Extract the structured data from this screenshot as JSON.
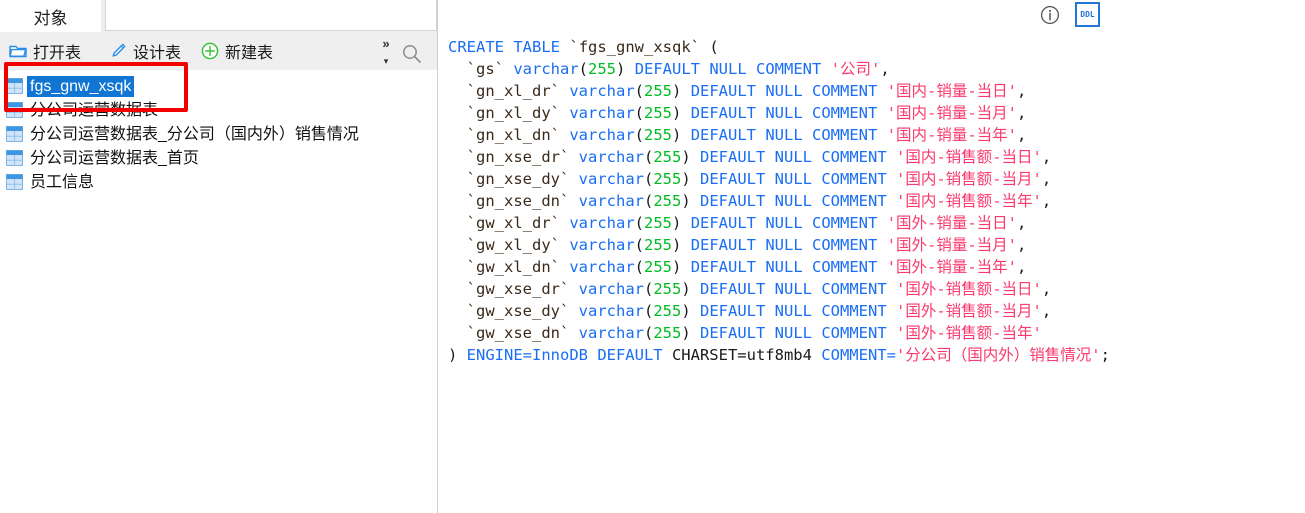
{
  "window": {
    "left_panel": {
      "tabs": [
        {
          "label": "对象",
          "name": "tab-object",
          "active": true
        }
      ],
      "toolbar": {
        "open_table_label": "打开表",
        "design_table_label": "设计表",
        "new_table_label": "新建表",
        "overflow_chevron": "»",
        "overflow_caret": "▾",
        "search_icon": "search-icon"
      },
      "object_list": [
        {
          "label": "fgs_gnw_xsqk",
          "selected": true,
          "icon": "table-icon"
        },
        {
          "label": "分公司运营数据表",
          "selected": false,
          "icon": "table-icon"
        },
        {
          "label": "分公司运营数据表_分公司（国内外）销售情况",
          "selected": false,
          "icon": "table-icon"
        },
        {
          "label": "分公司运营数据表_首页",
          "selected": false,
          "icon": "table-icon"
        },
        {
          "label": "员工信息",
          "selected": false,
          "icon": "table-icon"
        }
      ],
      "annotation": {
        "color": "#f20000",
        "shape": "rectangle",
        "target": "fgs_gnw_xsqk"
      }
    },
    "right_panel": {
      "toolbar": {
        "info_icon": "info-circle-icon",
        "ddl_button_label": "DDL"
      },
      "colors": {
        "keyword": "#1a6ef5",
        "identifier": "#3a2a1a",
        "number": "#00bb22",
        "string": "#fb3a6e",
        "plain": "#1a1a1a",
        "selection": "#1175d3",
        "annotation": "#f20000",
        "toolbar_bg": "#efefef"
      },
      "ddl": {
        "header": {
          "create": "CREATE",
          "table": "TABLE",
          "name": "`fgs_gnw_xsqk`",
          "paren": "("
        },
        "columns": [
          {
            "name": "`gs`",
            "type": "varchar",
            "length": "255",
            "nullability": "DEFAULT NULL",
            "comment_kw": "COMMENT",
            "comment": "'公司'",
            "trailing": ","
          },
          {
            "name": "`gn_xl_dr`",
            "type": "varchar",
            "length": "255",
            "nullability": "DEFAULT NULL",
            "comment_kw": "COMMENT",
            "comment": "'国内-销量-当日'",
            "trailing": ","
          },
          {
            "name": "`gn_xl_dy`",
            "type": "varchar",
            "length": "255",
            "nullability": "DEFAULT NULL",
            "comment_kw": "COMMENT",
            "comment": "'国内-销量-当月'",
            "trailing": ","
          },
          {
            "name": "`gn_xl_dn`",
            "type": "varchar",
            "length": "255",
            "nullability": "DEFAULT NULL",
            "comment_kw": "COMMENT",
            "comment": "'国内-销量-当年'",
            "trailing": ","
          },
          {
            "name": "`gn_xse_dr`",
            "type": "varchar",
            "length": "255",
            "nullability": "DEFAULT NULL",
            "comment_kw": "COMMENT",
            "comment": "'国内-销售额-当日'",
            "trailing": ","
          },
          {
            "name": "`gn_xse_dy`",
            "type": "varchar",
            "length": "255",
            "nullability": "DEFAULT NULL",
            "comment_kw": "COMMENT",
            "comment": "'国内-销售额-当月'",
            "trailing": ","
          },
          {
            "name": "`gn_xse_dn`",
            "type": "varchar",
            "length": "255",
            "nullability": "DEFAULT NULL",
            "comment_kw": "COMMENT",
            "comment": "'国内-销售额-当年'",
            "trailing": ","
          },
          {
            "name": "`gw_xl_dr`",
            "type": "varchar",
            "length": "255",
            "nullability": "DEFAULT NULL",
            "comment_kw": "COMMENT",
            "comment": "'国外-销量-当日'",
            "trailing": ","
          },
          {
            "name": "`gw_xl_dy`",
            "type": "varchar",
            "length": "255",
            "nullability": "DEFAULT NULL",
            "comment_kw": "COMMENT",
            "comment": "'国外-销量-当月'",
            "trailing": ","
          },
          {
            "name": "`gw_xl_dn`",
            "type": "varchar",
            "length": "255",
            "nullability": "DEFAULT NULL",
            "comment_kw": "COMMENT",
            "comment": "'国外-销量-当年'",
            "trailing": ","
          },
          {
            "name": "`gw_xse_dr`",
            "type": "varchar",
            "length": "255",
            "nullability": "DEFAULT NULL",
            "comment_kw": "COMMENT",
            "comment": "'国外-销售额-当日'",
            "trailing": ","
          },
          {
            "name": "`gw_xse_dy`",
            "type": "varchar",
            "length": "255",
            "nullability": "DEFAULT NULL",
            "comment_kw": "COMMENT",
            "comment": "'国外-销售额-当月'",
            "trailing": ","
          },
          {
            "name": "`gw_xse_dn`",
            "type": "varchar",
            "length": "255",
            "nullability": "DEFAULT NULL",
            "comment_kw": "COMMENT",
            "comment": "'国外-销售额-当年'",
            "trailing": ""
          }
        ],
        "footer": {
          "close_paren": ")",
          "engine": "ENGINE=InnoDB DEFAULT",
          "charset": "CHARSET=utf8mb4",
          "comment_kw": "COMMENT=",
          "comment": "'分公司（国内外）销售情况'",
          "terminator": ";"
        }
      }
    }
  }
}
